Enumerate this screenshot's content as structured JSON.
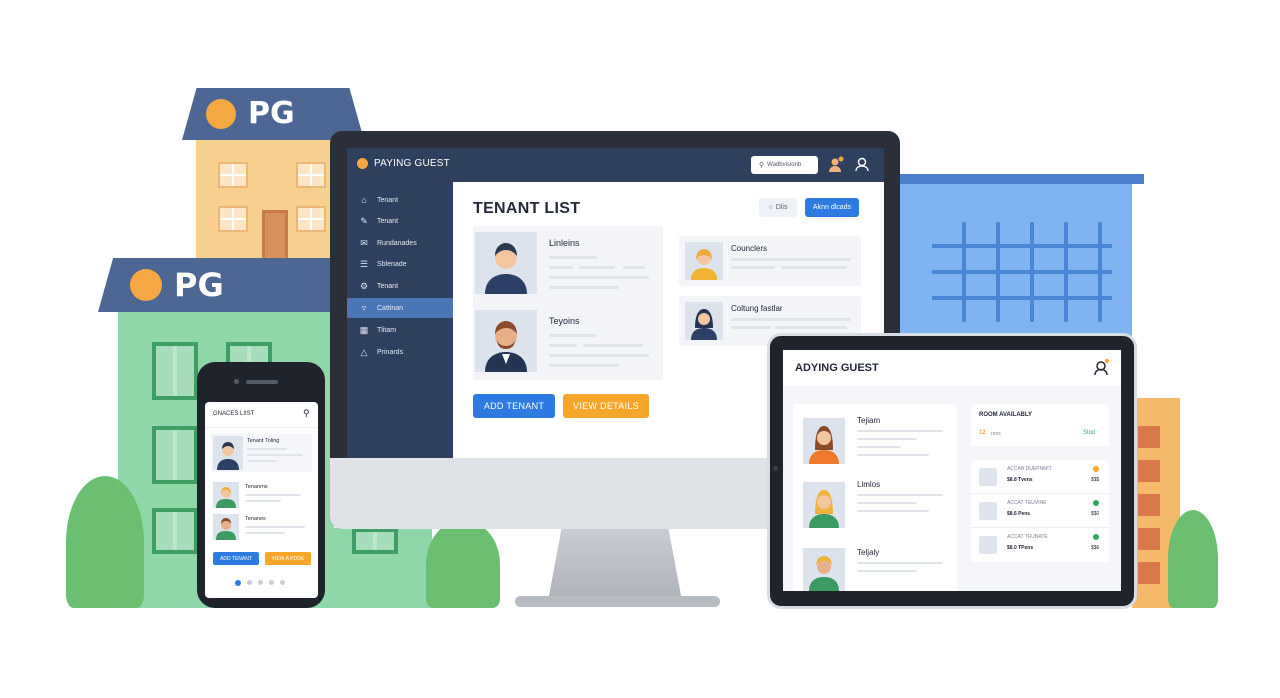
{
  "colors": {
    "navy": "#2f3f5e",
    "accent_blue": "#2d7be0",
    "accent_orange": "#f5a62b",
    "building_orange": "#f7cf8e",
    "building_green": "#8fd6a8",
    "building_blue": "#7fb3f2"
  },
  "buildings": {
    "back_logo": "PG",
    "front_logo": "PG"
  },
  "desktop": {
    "brand": "PAYING GUEST",
    "search_placeholder": "Wadbvisionb",
    "icons": [
      "search-icon",
      "notification-avatar-icon",
      "user-icon"
    ],
    "sidebar": [
      {
        "label": "Tenant",
        "icon": "home-icon"
      },
      {
        "label": "Tenant",
        "icon": "pencil-icon"
      },
      {
        "label": "Rundanades",
        "icon": "envelope-icon"
      },
      {
        "label": "Sblenade",
        "icon": "list-icon"
      },
      {
        "label": "Tenant",
        "icon": "gear-icon"
      },
      {
        "label": "Cattinan",
        "icon": "filter-icon",
        "active": true
      },
      {
        "label": "Tlitam",
        "icon": "calendar-icon"
      },
      {
        "label": "Prinards",
        "icon": "bell-icon"
      }
    ],
    "title": "TENANT LIST",
    "filter_label": "Dlis",
    "top_button": "Aknn dlcads",
    "tenants_left": [
      {
        "name": "Linleins"
      },
      {
        "name": "Teyoins"
      }
    ],
    "tenants_right": [
      {
        "name": "Counclers"
      },
      {
        "name": "Coltung fastlar"
      }
    ],
    "add_button": "ADD TENANT",
    "view_button": "VIEW DETAILS"
  },
  "phone": {
    "title": "GNACES LIIST",
    "tenants": [
      {
        "name": "Tenant Toling"
      },
      {
        "name": "Tenanrns"
      },
      {
        "name": "Tenanes"
      }
    ],
    "add_button": "ADD TENANT",
    "view_button": "VIEW A PDOE",
    "pagination_active": 0,
    "pagination_count": 5
  },
  "tablet": {
    "title": "ADYING GUEST",
    "tenants": [
      {
        "name": "Tejiam"
      },
      {
        "name": "Limlos"
      },
      {
        "name": "Teljaly"
      }
    ],
    "room_title": "ROOM AVAILABLY",
    "room_count": "12",
    "room_unit": "rons",
    "room_status": "Slod",
    "rooms": [
      {
        "title": "ACCAB DUEPNMIT",
        "price": "$8.8 Tvens",
        "value": "$$$",
        "status": "orange"
      },
      {
        "title": "ACCAT TEUVINE",
        "price": "$8.6 Pens",
        "value": "$$0",
        "status": "green"
      },
      {
        "title": "ACCAT TEUNATE",
        "price": "$8.0 TPens",
        "value": "$$6",
        "status": "green"
      }
    ]
  }
}
